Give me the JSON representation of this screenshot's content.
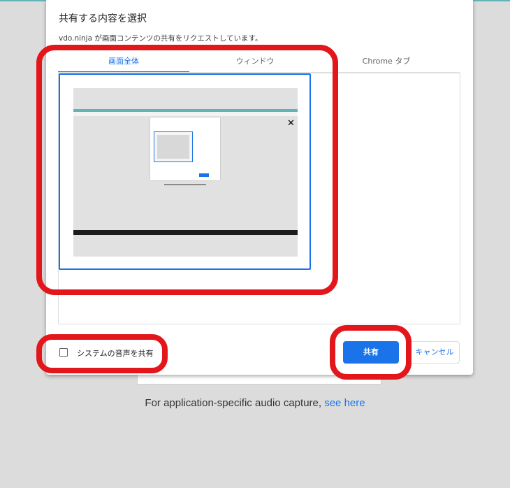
{
  "dialog": {
    "title": "共有する内容を選択",
    "subtitle": "vdo.ninja が画面コンテンツの共有をリクエストしています。",
    "tabs": [
      "画面全体",
      "ウィンドウ",
      "Chrome タブ"
    ],
    "active_tab": "画面全体",
    "checkbox_label": "システムの音声を共有",
    "checkbox_checked": false,
    "share_label": "共有",
    "cancel_label": "キャンセル"
  },
  "thumbnail": {
    "close_glyph": "✕"
  },
  "footnote": {
    "text": "For application-specific audio capture, ",
    "link": "see here"
  },
  "colors": {
    "accent": "#1a73e8",
    "highlight": "#e3161c",
    "teal": "#5fb3b9"
  }
}
